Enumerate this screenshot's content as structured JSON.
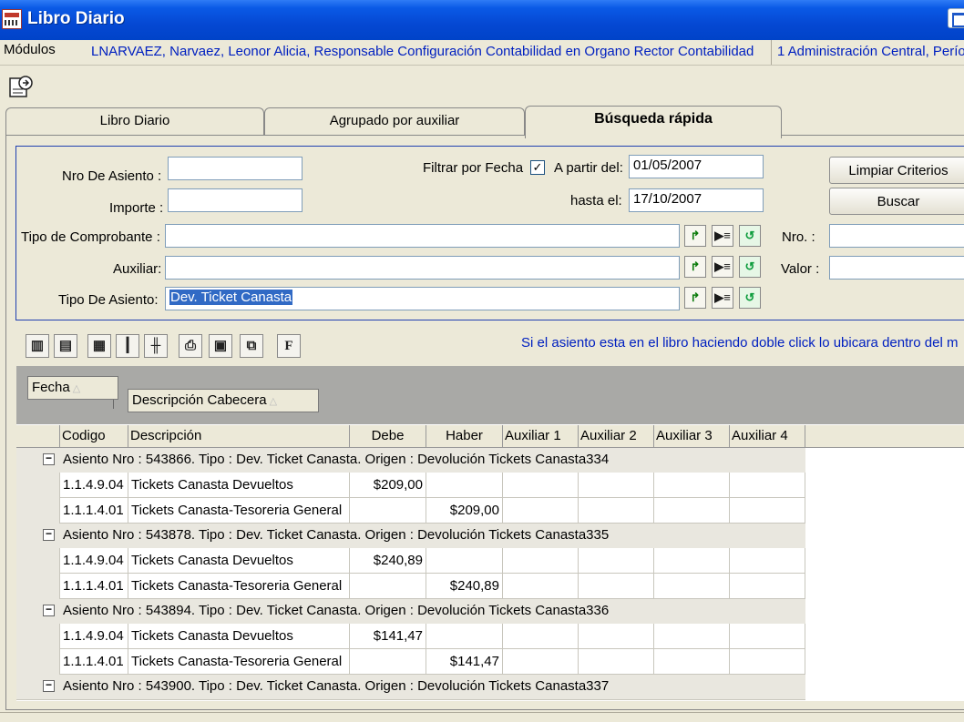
{
  "window": {
    "title": "Libro Diario"
  },
  "modules_bar": {
    "label": "Módulos",
    "user": "LNARVAEZ, Narvaez, Leonor Alicia, Responsable Configuración Contabilidad en Organo Rector Contabilidad",
    "entity": "1 Administración Central, Perío"
  },
  "tabs": [
    {
      "label": "Libro Diario"
    },
    {
      "label": "Agrupado por auxiliar"
    },
    {
      "label": "Búsqueda rápida"
    }
  ],
  "criteria": {
    "nro_asiento_label": "Nro De Asiento :",
    "nro_asiento_value": "",
    "importe_label": "Importe :",
    "importe_value": "",
    "filtrar_label": "Filtrar por Fecha",
    "filtrar_checked": "✓",
    "desde_label": "A partir del:",
    "desde_value": "01/05/2007",
    "hasta_label": "hasta el:",
    "hasta_value": "17/10/2007",
    "tipo_comp_label": "Tipo de Comprobante :",
    "tipo_comp_value": "",
    "auxiliar_label": "Auxiliar:",
    "auxiliar_value": "",
    "tipo_asiento_label": "Tipo De Asiento:",
    "tipo_asiento_value": "Dev. Ticket Canasta",
    "nro_label": "Nro. :",
    "valor_label": "Valor :",
    "limpiar_label": "Limpiar Criterios",
    "buscar_label": "Buscar"
  },
  "hint": "Si el asiento esta en el libro haciendo doble click lo ubicara dentro del m",
  "group_by": [
    "Fecha",
    "Descripción Cabecera"
  ],
  "columns": [
    "Codigo",
    "Descripción",
    "Debe",
    "Haber",
    "Auxiliar 1",
    "Auxiliar 2",
    "Auxiliar 3",
    "Auxiliar 4"
  ],
  "groups": [
    {
      "header": "Asiento Nro : 543866. Tipo : Dev. Ticket Canasta. Origen : Devolución Tickets Canasta334",
      "rows": [
        {
          "codigo": "1.1.4.9.04",
          "descripcion": "Tickets Canasta Devueltos",
          "debe": "$209,00",
          "haber": ""
        },
        {
          "codigo": "1.1.1.4.01",
          "descripcion": "Tickets Canasta-Tesoreria General",
          "debe": "",
          "haber": "$209,00"
        }
      ]
    },
    {
      "header": "Asiento Nro : 543878. Tipo : Dev. Ticket Canasta. Origen : Devolución Tickets Canasta335",
      "rows": [
        {
          "codigo": "1.1.4.9.04",
          "descripcion": "Tickets Canasta Devueltos",
          "debe": "$240,89",
          "haber": ""
        },
        {
          "codigo": "1.1.1.4.01",
          "descripcion": "Tickets Canasta-Tesoreria General",
          "debe": "",
          "haber": "$240,89"
        }
      ]
    },
    {
      "header": "Asiento Nro : 543894. Tipo : Dev. Ticket Canasta. Origen : Devolución Tickets Canasta336",
      "rows": [
        {
          "codigo": "1.1.4.9.04",
          "descripcion": "Tickets Canasta Devueltos",
          "debe": "$141,47",
          "haber": ""
        },
        {
          "codigo": "1.1.1.4.01",
          "descripcion": "Tickets Canasta-Tesoreria General",
          "debe": "",
          "haber": "$141,47"
        }
      ]
    },
    {
      "header": "Asiento Nro : 543900. Tipo : Dev. Ticket Canasta. Origen : Devolución Tickets Canasta337",
      "rows": []
    }
  ],
  "icons": {
    "app": "app-icon",
    "export": "export-icon",
    "lookup": [
      "select-icon",
      "list-icon",
      "undo-icon"
    ],
    "toolbar": [
      "column-chooser-icon",
      "save-layout-icon",
      "expand-icon",
      "split-icon",
      "collapse-icon",
      "print-icon",
      "preview-icon",
      "copy-icon",
      "font-icon"
    ]
  }
}
